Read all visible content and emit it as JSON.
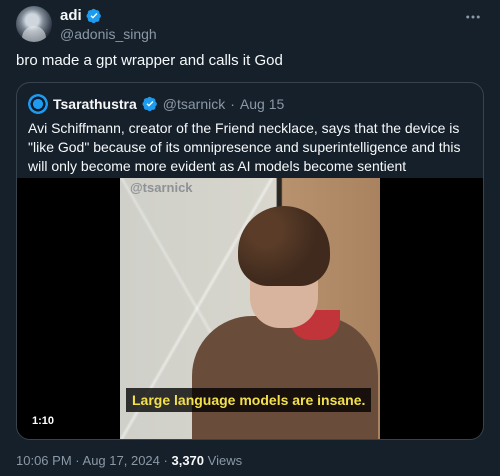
{
  "author": {
    "name": "adi",
    "handle": "@adonis_singh"
  },
  "more_icon": "more-icon",
  "tweet_text": "bro made a gpt wrapper and calls it God",
  "quote": {
    "name": "Tsarathustra",
    "handle": "@tsarnick",
    "separator": "·",
    "date": "Aug 15",
    "text": "Avi Schiffmann, creator of the Friend necklace, says that the device is \"like God\" because of its omnipresence and superintelligence and this will only become more evident as AI models become sentient",
    "media": {
      "watermark": "@tsarnick",
      "caption": "Large language models are insane.",
      "duration": "1:10"
    }
  },
  "footer": {
    "time": "10:06 PM",
    "dot1": "·",
    "date": "Aug 17, 2024",
    "dot2": "·",
    "views_count": "3,370",
    "views_label": "Views"
  },
  "colors": {
    "background": "#15202b",
    "verified": "#1d9bf0",
    "muted": "#8b98a5",
    "caption": "#f4e04a"
  }
}
